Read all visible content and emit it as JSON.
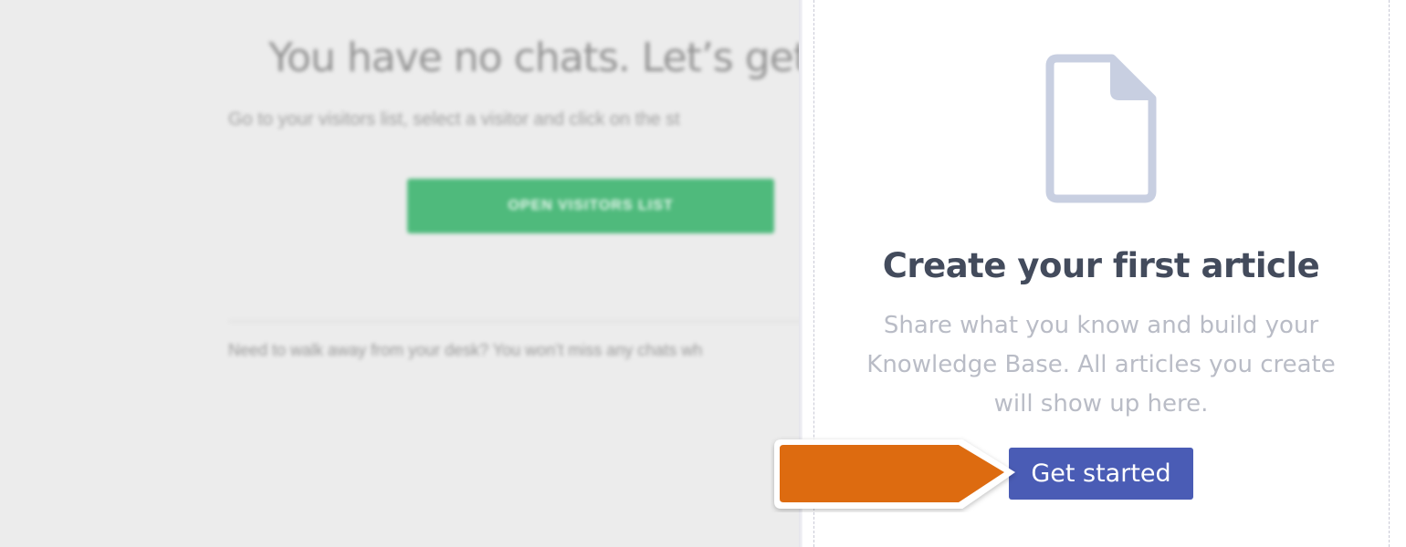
{
  "background": {
    "title": "You have no chats. Let’s get",
    "subtitle": "Go to your visitors list, select a visitor and click on the st",
    "button_label": "OPEN VISITORS LIST",
    "footnote": "Need to walk away from your desk? You won’t miss any chats wh"
  },
  "panel": {
    "icon": "document-icon",
    "title": "Create your first article",
    "description": "Share what you know and build your Knowledge Base. All articles you create will show up here.",
    "cta_label": "Get started"
  },
  "colors": {
    "cta": "#4a5cb5",
    "arrow": "#dd6b10",
    "bg_button": "#4fba7c",
    "title": "#434b5c",
    "description": "#b9bcc6"
  }
}
